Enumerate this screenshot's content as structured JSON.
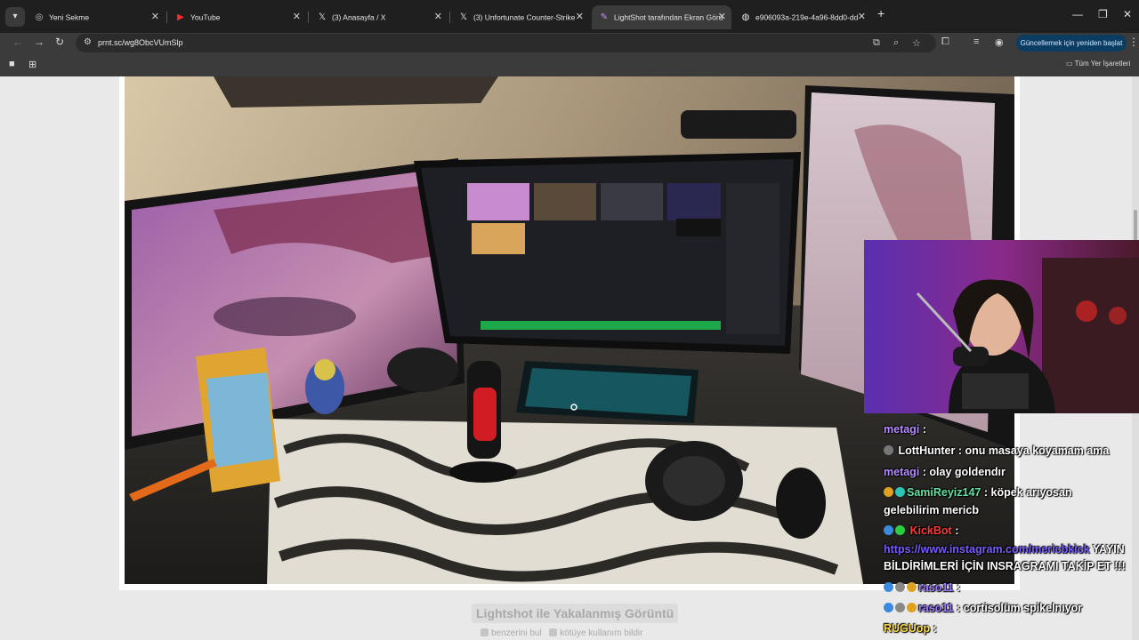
{
  "browser": {
    "tabs": [
      {
        "title": "Yeni Sekme",
        "icon": "chrome-icon"
      },
      {
        "title": "YouTube",
        "icon": "youtube-icon"
      },
      {
        "title": "(3) Anasayfa / X",
        "icon": "x-icon"
      },
      {
        "title": "(3) Unfortunate Counter-Strike",
        "icon": "x-icon"
      },
      {
        "title": "LightShot tarafından Ekran Görü",
        "icon": "lightshot-icon",
        "active": true
      },
      {
        "title": "e906093a-219e-4a96-8dd0-dd",
        "icon": "globe-icon"
      }
    ],
    "url": "prnt.sc/wg8ObcVUmSlp",
    "update_button": "Güncellemek için yeniden başlat",
    "bookmarks_label": "Tüm Yer İşaretleri"
  },
  "page": {
    "caption": "Lightshot ile Yakalanmış Görüntü",
    "link_similar": "benzerini bul",
    "link_abuse": "kötüye kullanım bildir"
  },
  "overlay_chat": [
    {
      "user": "metagi",
      "text": ":",
      "user_color": "#b58cff"
    },
    {
      "user": "LottHunter",
      "text": ": onu masaya koyamam ama",
      "user_color": "#ffffff"
    },
    {
      "user": "metagi",
      "text": ": olay goldendır",
      "user_color": "#b58cff"
    },
    {
      "user": "SamiReyiz147",
      "text": ": köpek arıyosan",
      "user_color": "#5fe3a1"
    },
    {
      "user": "",
      "text": "gelebilirim mericb",
      "user_color": "#ffffff"
    },
    {
      "user": "KickBot",
      "text": ":",
      "user_color": "#ff3a3a"
    },
    {
      "user": "https://www.instagram.com/mericbkick",
      "text": "YAYIN",
      "user_color": "#7a5cff"
    },
    {
      "user": "",
      "text": "BİLDİRİMLERİ İÇİN INSRAGRAMI TAKİP ET !!!",
      "user_color": "#ffffff"
    },
    {
      "user": "raso11",
      "text": ":",
      "user_color": "#9b7bff"
    },
    {
      "user": "raso11",
      "text": ": cortisolüm spikelnıyor",
      "user_color": "#9b7bff"
    },
    {
      "user": "RUGUop",
      "text": ":",
      "user_color": "#ffd84a"
    }
  ],
  "colors": {
    "tabbar": "#1f1f1f",
    "toolbar": "#3b3b3b",
    "update_button": "#0b3d63",
    "page_bg": "#e9e9e9"
  }
}
